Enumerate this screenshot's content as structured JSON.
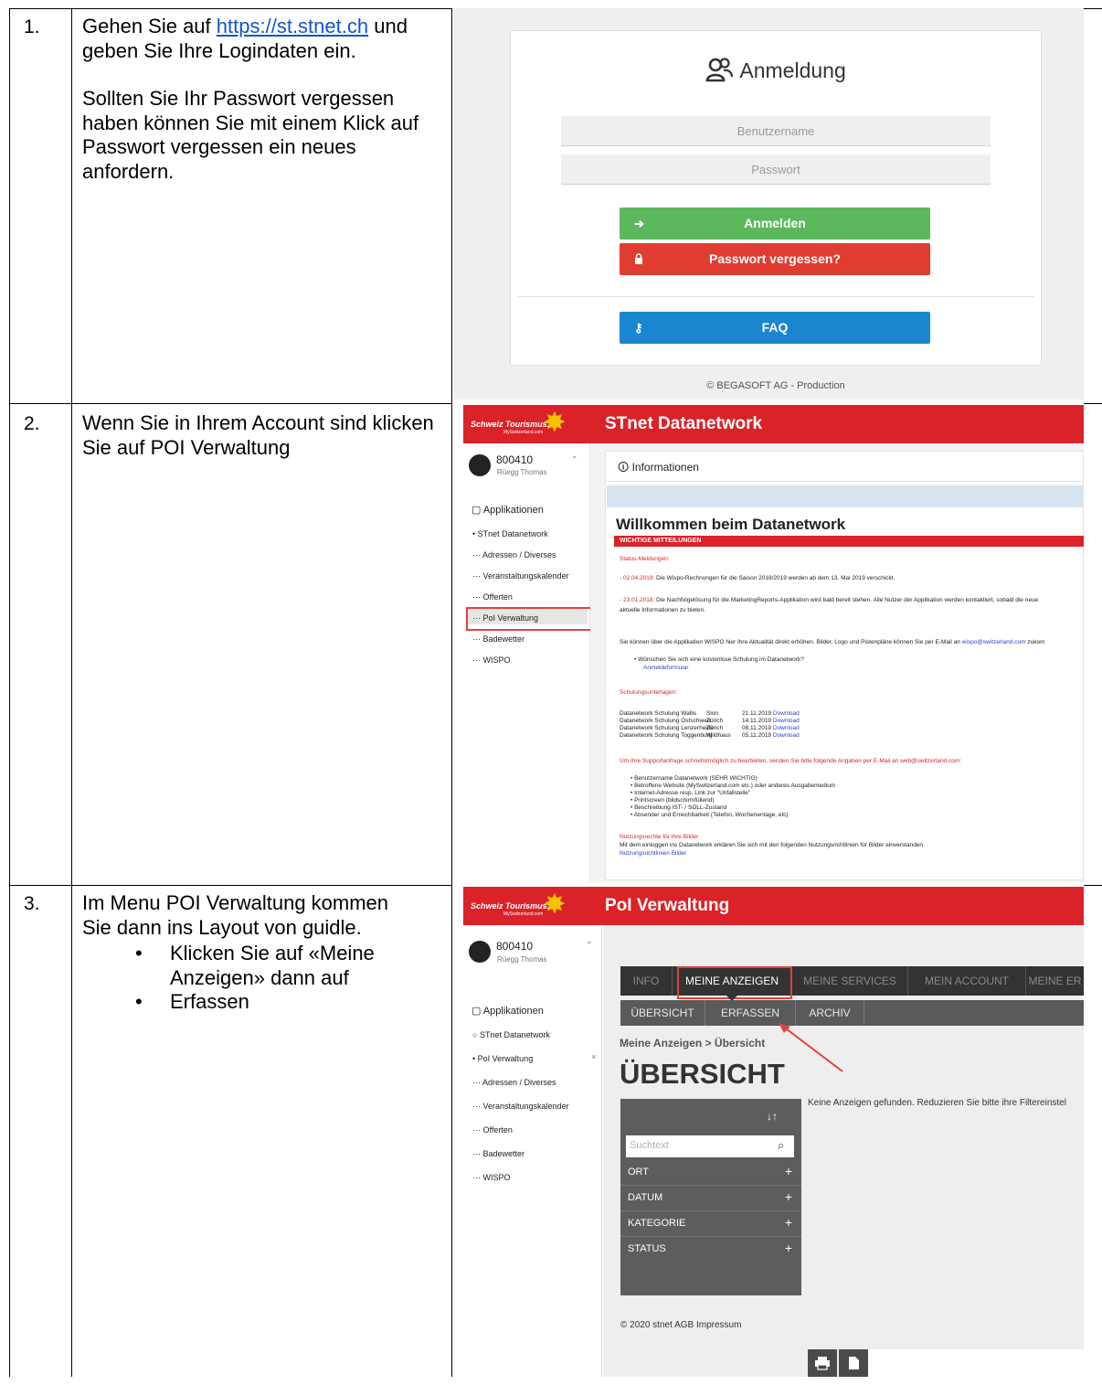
{
  "rows": [
    {
      "number": "1.",
      "link": "https://st.stnet.ch",
      "text_after_link": "und geben Sie Ihre Logindaten ein.",
      "text_line1_prefix": "Gehen Sie auf",
      "paragraph2": "Sollten Sie Ihr Passwort vergessen haben können Sie mit einem Klick auf Passwort vergessen ein neues anfordern."
    },
    {
      "number": "2.",
      "paragraph": "Wenn Sie in Ihrem Account sind klicken Sie auf POI Verwaltung"
    },
    {
      "number": "3.",
      "paragraph": "Im Menu POI Verwaltung kommen Sie dann ins Layout von guidle.",
      "bullets": [
        "Klicken Sie auf «Meine Anzeigen» dann auf",
        "Erfassen"
      ]
    }
  ],
  "login": {
    "title": "Anmeldung",
    "username_placeholder": "Benutzername",
    "password_placeholder": "Passwort",
    "login_button": "Anmelden",
    "forgot_button": "Passwort vergessen?",
    "faq_button": "FAQ",
    "footer": "© BEGASOFT AG - Production",
    "colors": {
      "login": "#5cb85c",
      "forgot": "#e03c31",
      "faq": "#1a86d0"
    },
    "icons": {
      "title": "users-icon",
      "login": "sign-in-icon",
      "forgot": "lock-icon",
      "faq": "key-icon"
    }
  },
  "stnet": {
    "logo_text": "Schweiz Tourismus.",
    "logo_sub": "MySwitzerland.com",
    "title": "STnet Datanetwork",
    "user_number": "800410",
    "user_name": "Rüegg Thomas",
    "apps_heading": "Applikationen",
    "apps": [
      "STnet Datanetwork",
      "Adressen / Diverses",
      "Veranstaltungskalender",
      "Offerten",
      "PoI Verwaltung",
      "Badewetter",
      "WISPO"
    ],
    "info_heading": "Informationen",
    "welcome": "Willkommen beim Datanetwork",
    "important": "WICHTIGE MITTEILUNGEN",
    "status_heading": "Status-Meldungen:",
    "msg1_date": "- 02.04.2019:",
    "msg1_text": "Die Wispo-Rechnungen für die Saison 2018/2019 werden ab dem 13. Mai 2019 verschickt.",
    "msg2_date": "- 23.01.2018:",
    "msg2_text": "Die Nachfolgelösung für die MarketingReports-Applikation wird bald bereit stehen. Alle Nutzer der Applikation werden kontaktiert, sobald die neue",
    "msg2_text2": "aktuelle Informationen zu bieten.",
    "wispo_line": "Sie können über die Applikation WISPO hier Ihre Aktualität direkt erhöhen. Bilder, Logo und Pistenpläne können Sie per E-Mail an",
    "wispo_email": "wispo@switzerland.com",
    "wispo_tail": "zukom",
    "training_q": "Wünschen Sie sich eine kostenlose Schulung im Datanetwork?",
    "training_link": "Anmeldeformular",
    "docs_heading": "Schulungsunterlagen:",
    "docs": [
      {
        "name": "Datanetwork Schulung Wallis",
        "place": "Sion",
        "date": "21.11.2019",
        "link": "Download"
      },
      {
        "name": "Datanetwork Schulung Ostschweiz",
        "place": "Zürich",
        "date": "14.11.2019",
        "link": "Download"
      },
      {
        "name": "Datanetwork Schulung Lenzerheide",
        "place": "Zürich",
        "date": "08.11.2019",
        "link": "Download"
      },
      {
        "name": "Datanetwork Schulung Toggenburg",
        "place": "Wildhaus",
        "date": "05.11.2019",
        "link": "Download"
      }
    ],
    "support_line": "Um Ihre Supportanfrage schnellstmöglich zu bearbeiten, senden Sie bitte folgende Angaben per E-Mail an web@switzerland.com:",
    "support_items": [
      "Benutzername Datanetwork (SEHR WICHTIG)",
      "Betroffene Website (MySwitzerland.com etc.) oder anderes Ausgabemedium",
      "Internet-Adresse resp. Link zur \"Unfallstelle\"",
      "Printscreen (bildschirmfüllend)",
      "Beschreibung IST- / SOLL-Zustand",
      "Absender und Erreichbarkeit (Telefon, Wochenentage, etc)"
    ],
    "rights_heading": "Nutzungsrechte für Ihre Bilder",
    "rights_text": "Mit dem einloggen ins Datanetwork erklären Sie sich mit den folgenden Nutzungsrichtlinien für Bilder einverstanden",
    "rights_link": "Nutzungsrichtlinien Bilder"
  },
  "guidle": {
    "title": "PoI Verwaltung",
    "apps": [
      "STnet Datanetwork",
      "PoI Verwaltung",
      "Adressen / Diverses",
      "Veranstaltungskalender",
      "Offerten",
      "Badewetter",
      "WISPO"
    ],
    "close_symbol": "×",
    "nav": [
      "INFO",
      "MEINE ANZEIGEN",
      "MEINE SERVICES",
      "MEIN ACCOUNT",
      "MEINE ER"
    ],
    "subnav": [
      "ÜBERSICHT",
      "ERFASSEN",
      "ARCHIV"
    ],
    "breadcrumb": "Meine Anzeigen > Übersicht",
    "heading": "ÜBERSICHT",
    "empty_msg": "Keine Anzeigen gefunden. Reduzieren Sie bitte ihre Filtereinstel",
    "sort_symbol": "↓↑",
    "search_placeholder": "Suchtext",
    "filters": [
      "ORT",
      "DATUM",
      "KATEGORIE",
      "STATUS"
    ],
    "footer": "© 2020 stnet  AGB  Impressum",
    "arrow_color": "#e2423b"
  }
}
